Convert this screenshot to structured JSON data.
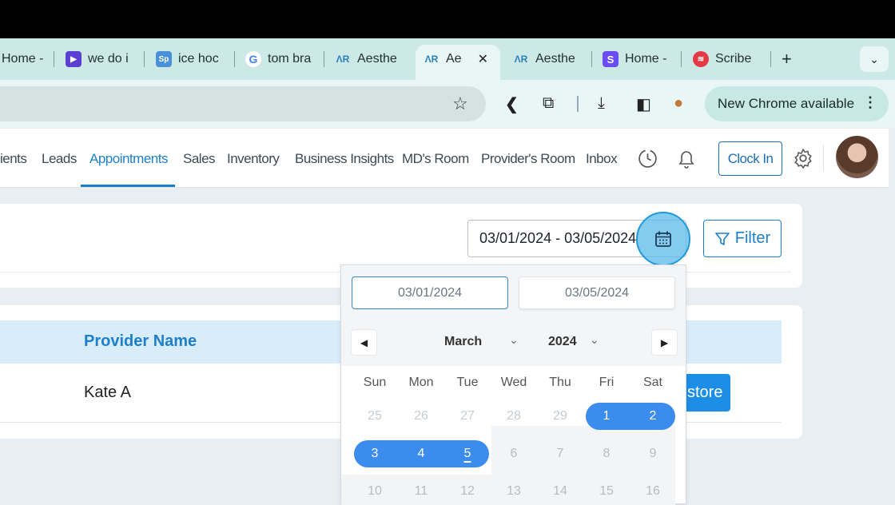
{
  "browser": {
    "tabs": [
      {
        "label": "Home -",
        "icon": "home-tab-icon",
        "color": "#cde9e7"
      },
      {
        "label": "we do i",
        "icon": "video-icon",
        "color": "#6b3fd6"
      },
      {
        "label": "ice hoc",
        "icon": "sp-icon",
        "color": "#4a90d9"
      },
      {
        "label": "tom bra",
        "icon": "google-icon",
        "color": "#ffffff"
      },
      {
        "label": "Aesthe",
        "icon": "ar-logo-icon",
        "color": "#cde9e7"
      },
      {
        "label": "Ae",
        "icon": "ar-logo-icon",
        "color": "#e8f6f5"
      },
      {
        "label": "Aesthe",
        "icon": "ar-logo-icon",
        "color": "#cde9e7"
      },
      {
        "label": "Home -",
        "icon": "s-icon",
        "color": "#6a4df2"
      },
      {
        "label": "Scribe",
        "icon": "scribe-icon",
        "color": "#e63946"
      }
    ],
    "new_tab": "+",
    "update_label": "New Chrome available"
  },
  "nav": {
    "items": [
      "ients",
      "Leads",
      "Appointments",
      "Sales",
      "Inventory",
      "Business Insights",
      "MD's Room",
      "Provider's Room",
      "Inbox"
    ],
    "active": "Appointments",
    "clock_in": "Clock In"
  },
  "filter": {
    "date_range": "03/01/2024 - 03/05/2024",
    "filter_label": "Filter"
  },
  "table": {
    "header": "Provider Name",
    "rows": [
      {
        "provider": "Kate A",
        "action": "store"
      }
    ]
  },
  "calendar": {
    "start_date": "03/01/2024",
    "end_date": "03/05/2024",
    "month": "March",
    "year": "2024",
    "weekdays": [
      "Sun",
      "Mon",
      "Tue",
      "Wed",
      "Thu",
      "Fri",
      "Sat"
    ],
    "weeks": [
      [
        "25",
        "26",
        "27",
        "28",
        "29",
        "1",
        "2"
      ],
      [
        "3",
        "4",
        "5",
        "6",
        "7",
        "8",
        "9"
      ],
      [
        "10",
        "11",
        "12",
        "13",
        "14",
        "15",
        "16"
      ]
    ],
    "selected": [
      "1",
      "2",
      "3",
      "4",
      "5"
    ],
    "accent": "#3b8ced"
  }
}
